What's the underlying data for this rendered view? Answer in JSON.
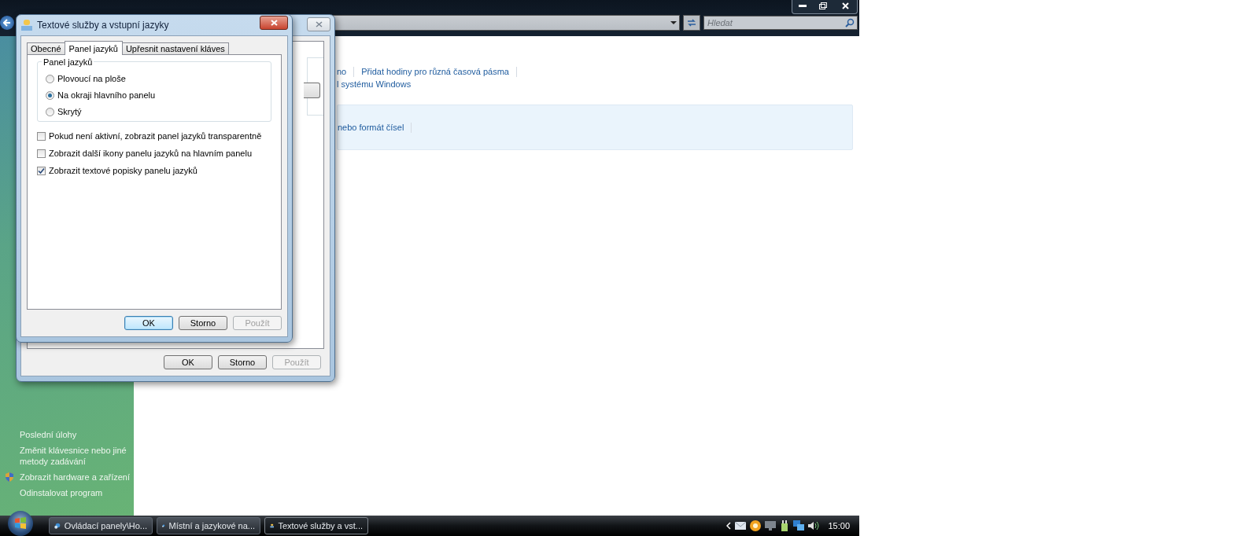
{
  "explorer": {
    "search": {
      "placeholder": "Hledat"
    },
    "links_row_1": [
      "no",
      "Přidat hodiny pro různá časová pásma"
    ],
    "links_row_2": [
      "l systému Windows"
    ],
    "highlight_links": [
      "nebo formát čísel"
    ]
  },
  "sidebar": {
    "heading": "Poslední úlohy",
    "items": [
      {
        "label": "Změnit klávesnice nebo jiné metody zadávání",
        "kind": "plain"
      },
      {
        "label": "Zobrazit hardware a zařízení",
        "kind": "shield"
      },
      {
        "label": "Odinstalovat program",
        "kind": "plain"
      }
    ]
  },
  "back_dialog": {
    "buttons": [
      {
        "label": "OK",
        "disabled": false
      },
      {
        "label": "Storno",
        "disabled": false
      },
      {
        "label": "Použít",
        "disabled": true
      }
    ]
  },
  "dialog": {
    "title": "Textové služby a vstupní jazyky",
    "tabs": [
      {
        "label": "Obecné",
        "selected": false
      },
      {
        "label": "Panel jazyků",
        "selected": true
      },
      {
        "label": "Upřesnit nastavení kláves",
        "selected": false
      }
    ],
    "group": {
      "legend": "Panel jazyků",
      "options": [
        {
          "label": "Plovoucí na ploše",
          "selected": false
        },
        {
          "label": "Na okraji hlavního panelu",
          "selected": true
        },
        {
          "label": "Skrytý",
          "selected": false
        }
      ]
    },
    "checkboxes": [
      {
        "label": "Pokud není aktivní, zobrazit panel jazyků transparentně",
        "checked": false
      },
      {
        "label": "Zobrazit další ikony panelu jazyků na hlavním panelu",
        "checked": false
      },
      {
        "label": "Zobrazit textové popisky panelu jazyků",
        "checked": true
      }
    ],
    "buttons": [
      {
        "label": "OK",
        "disabled": false,
        "default": true
      },
      {
        "label": "Storno",
        "disabled": false,
        "default": false
      },
      {
        "label": "Použít",
        "disabled": true,
        "default": false
      }
    ]
  },
  "taskbar": {
    "buttons": [
      {
        "label": "Ovládací panely\\Ho...",
        "selected": false
      },
      {
        "label": "Místní a jazykové na...",
        "selected": false
      },
      {
        "label": "Textové služby a vst...",
        "selected": true
      }
    ],
    "clock": "15:00"
  }
}
